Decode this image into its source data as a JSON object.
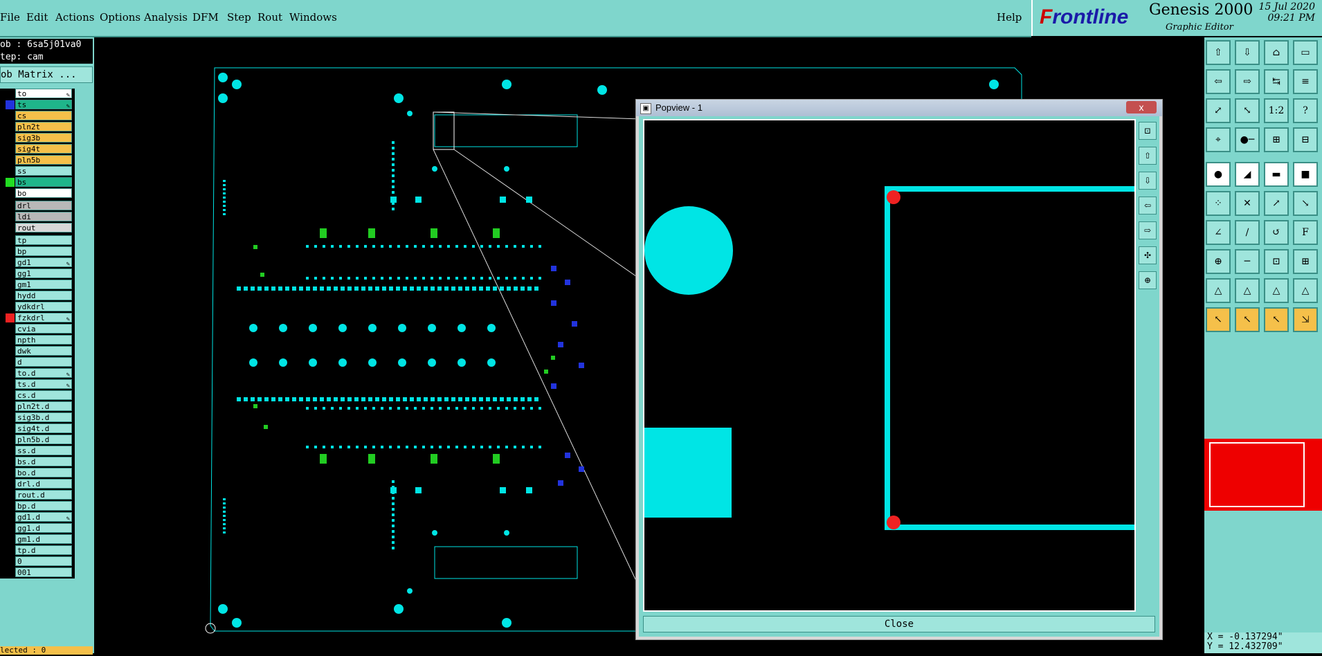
{
  "menu": {
    "items": [
      "File",
      "Edit",
      "Actions",
      "Options",
      "Analysis",
      "DFM",
      "Step",
      "Rout",
      "Windows"
    ],
    "help": "Help"
  },
  "brand": {
    "logo_prefix": "F",
    "logo_rest": "rontline",
    "product": "Genesis 2000",
    "subtitle": "Graphic Editor",
    "date": "15 Jul 2020",
    "time": "09:21 PM"
  },
  "job": {
    "job_line": "ob : 6sa5j01va0",
    "step_line": "tep: cam",
    "matrix_button": "ob Matrix ..."
  },
  "layers": [
    {
      "name": "to",
      "bg": "#ffffff",
      "sq": "#000000",
      "edit": true
    },
    {
      "name": "ts",
      "bg": "#1fb58a",
      "sq": "#2233dd",
      "edit": true
    },
    {
      "name": "cs",
      "bg": "#f5c04a",
      "sq": "#000000",
      "edit": false
    },
    {
      "name": "pln2t",
      "bg": "#f5c04a",
      "sq": "#000000",
      "edit": false
    },
    {
      "name": "sig3b",
      "bg": "#f5c04a",
      "sq": "#000000",
      "edit": false
    },
    {
      "name": "sig4t",
      "bg": "#f5c04a",
      "sq": "#000000",
      "edit": false
    },
    {
      "name": "pln5b",
      "bg": "#f5c04a",
      "sq": "#000000",
      "edit": false
    },
    {
      "name": "ss",
      "bg": "#9fe5dc",
      "sq": "#000000",
      "edit": false
    },
    {
      "name": "bs",
      "bg": "#1fb58a",
      "sq": "#22dd22",
      "edit": false
    },
    {
      "name": "bo",
      "bg": "#ffffff",
      "sq": "#000000",
      "edit": false
    },
    {
      "name": "drl",
      "bg": "#b8b8b8",
      "sq": "#000000",
      "edit": false
    },
    {
      "name": "ldi",
      "bg": "#b8b8b8",
      "sq": "#000000",
      "edit": false
    },
    {
      "name": "rout",
      "bg": "#d8d8d8",
      "sq": "#000000",
      "edit": false
    },
    {
      "name": "tp",
      "bg": "#9fe5dc",
      "sq": "#000000",
      "edit": false
    },
    {
      "name": "bp",
      "bg": "#9fe5dc",
      "sq": "#000000",
      "edit": false
    },
    {
      "name": "gd1",
      "bg": "#9fe5dc",
      "sq": "#000000",
      "edit": true
    },
    {
      "name": "gg1",
      "bg": "#9fe5dc",
      "sq": "#000000",
      "edit": false
    },
    {
      "name": "gm1",
      "bg": "#9fe5dc",
      "sq": "#000000",
      "edit": false
    },
    {
      "name": "hydd",
      "bg": "#9fe5dc",
      "sq": "#000000",
      "edit": false
    },
    {
      "name": "ydkdrl",
      "bg": "#9fe5dc",
      "sq": "#000000",
      "edit": false
    },
    {
      "name": "fzkdrl",
      "bg": "#9fe5dc",
      "sq": "#ee2222",
      "edit": true
    },
    {
      "name": "cvia",
      "bg": "#9fe5dc",
      "sq": "#000000",
      "edit": false
    },
    {
      "name": "npth",
      "bg": "#9fe5dc",
      "sq": "#000000",
      "edit": false
    },
    {
      "name": "dwk",
      "bg": "#9fe5dc",
      "sq": "#000000",
      "edit": false
    },
    {
      "name": "d",
      "bg": "#9fe5dc",
      "sq": "#000000",
      "edit": false
    },
    {
      "name": "to.d",
      "bg": "#9fe5dc",
      "sq": "#000000",
      "edit": true
    },
    {
      "name": "ts.d",
      "bg": "#9fe5dc",
      "sq": "#000000",
      "edit": true
    },
    {
      "name": "cs.d",
      "bg": "#9fe5dc",
      "sq": "#000000",
      "edit": false
    },
    {
      "name": "pln2t.d",
      "bg": "#9fe5dc",
      "sq": "#000000",
      "edit": false
    },
    {
      "name": "sig3b.d",
      "bg": "#9fe5dc",
      "sq": "#000000",
      "edit": false
    },
    {
      "name": "sig4t.d",
      "bg": "#9fe5dc",
      "sq": "#000000",
      "edit": false
    },
    {
      "name": "pln5b.d",
      "bg": "#9fe5dc",
      "sq": "#000000",
      "edit": false
    },
    {
      "name": "ss.d",
      "bg": "#9fe5dc",
      "sq": "#000000",
      "edit": false
    },
    {
      "name": "bs.d",
      "bg": "#9fe5dc",
      "sq": "#000000",
      "edit": false
    },
    {
      "name": "bo.d",
      "bg": "#9fe5dc",
      "sq": "#000000",
      "edit": false
    },
    {
      "name": "drl.d",
      "bg": "#9fe5dc",
      "sq": "#000000",
      "edit": false
    },
    {
      "name": "rout.d",
      "bg": "#9fe5dc",
      "sq": "#000000",
      "edit": false
    },
    {
      "name": "bp.d",
      "bg": "#9fe5dc",
      "sq": "#000000",
      "edit": false
    },
    {
      "name": "gd1.d",
      "bg": "#9fe5dc",
      "sq": "#000000",
      "edit": true
    },
    {
      "name": "gg1.d",
      "bg": "#9fe5dc",
      "sq": "#000000",
      "edit": false
    },
    {
      "name": "gm1.d",
      "bg": "#9fe5dc",
      "sq": "#000000",
      "edit": false
    },
    {
      "name": "tp.d",
      "bg": "#9fe5dc",
      "sq": "#000000",
      "edit": false
    },
    {
      "name": "0",
      "bg": "#9fe5dc",
      "sq": "#000000",
      "edit": false
    },
    {
      "name": "001",
      "bg": "#9fe5dc",
      "sq": "#000000",
      "edit": false
    }
  ],
  "status": {
    "selected": "lected : 0"
  },
  "popview": {
    "title": "Popview - 1",
    "close_label": "Close",
    "close_x": "x"
  },
  "coords": {
    "x": "X = -0.137294\"",
    "y": "Y = 12.432709\""
  },
  "colors": {
    "panel": "#7fd6cc",
    "copper": "#00e5e5",
    "highlight": "#ee2222",
    "signal_green": "#22cc22",
    "signal_blue": "#2233dd"
  }
}
